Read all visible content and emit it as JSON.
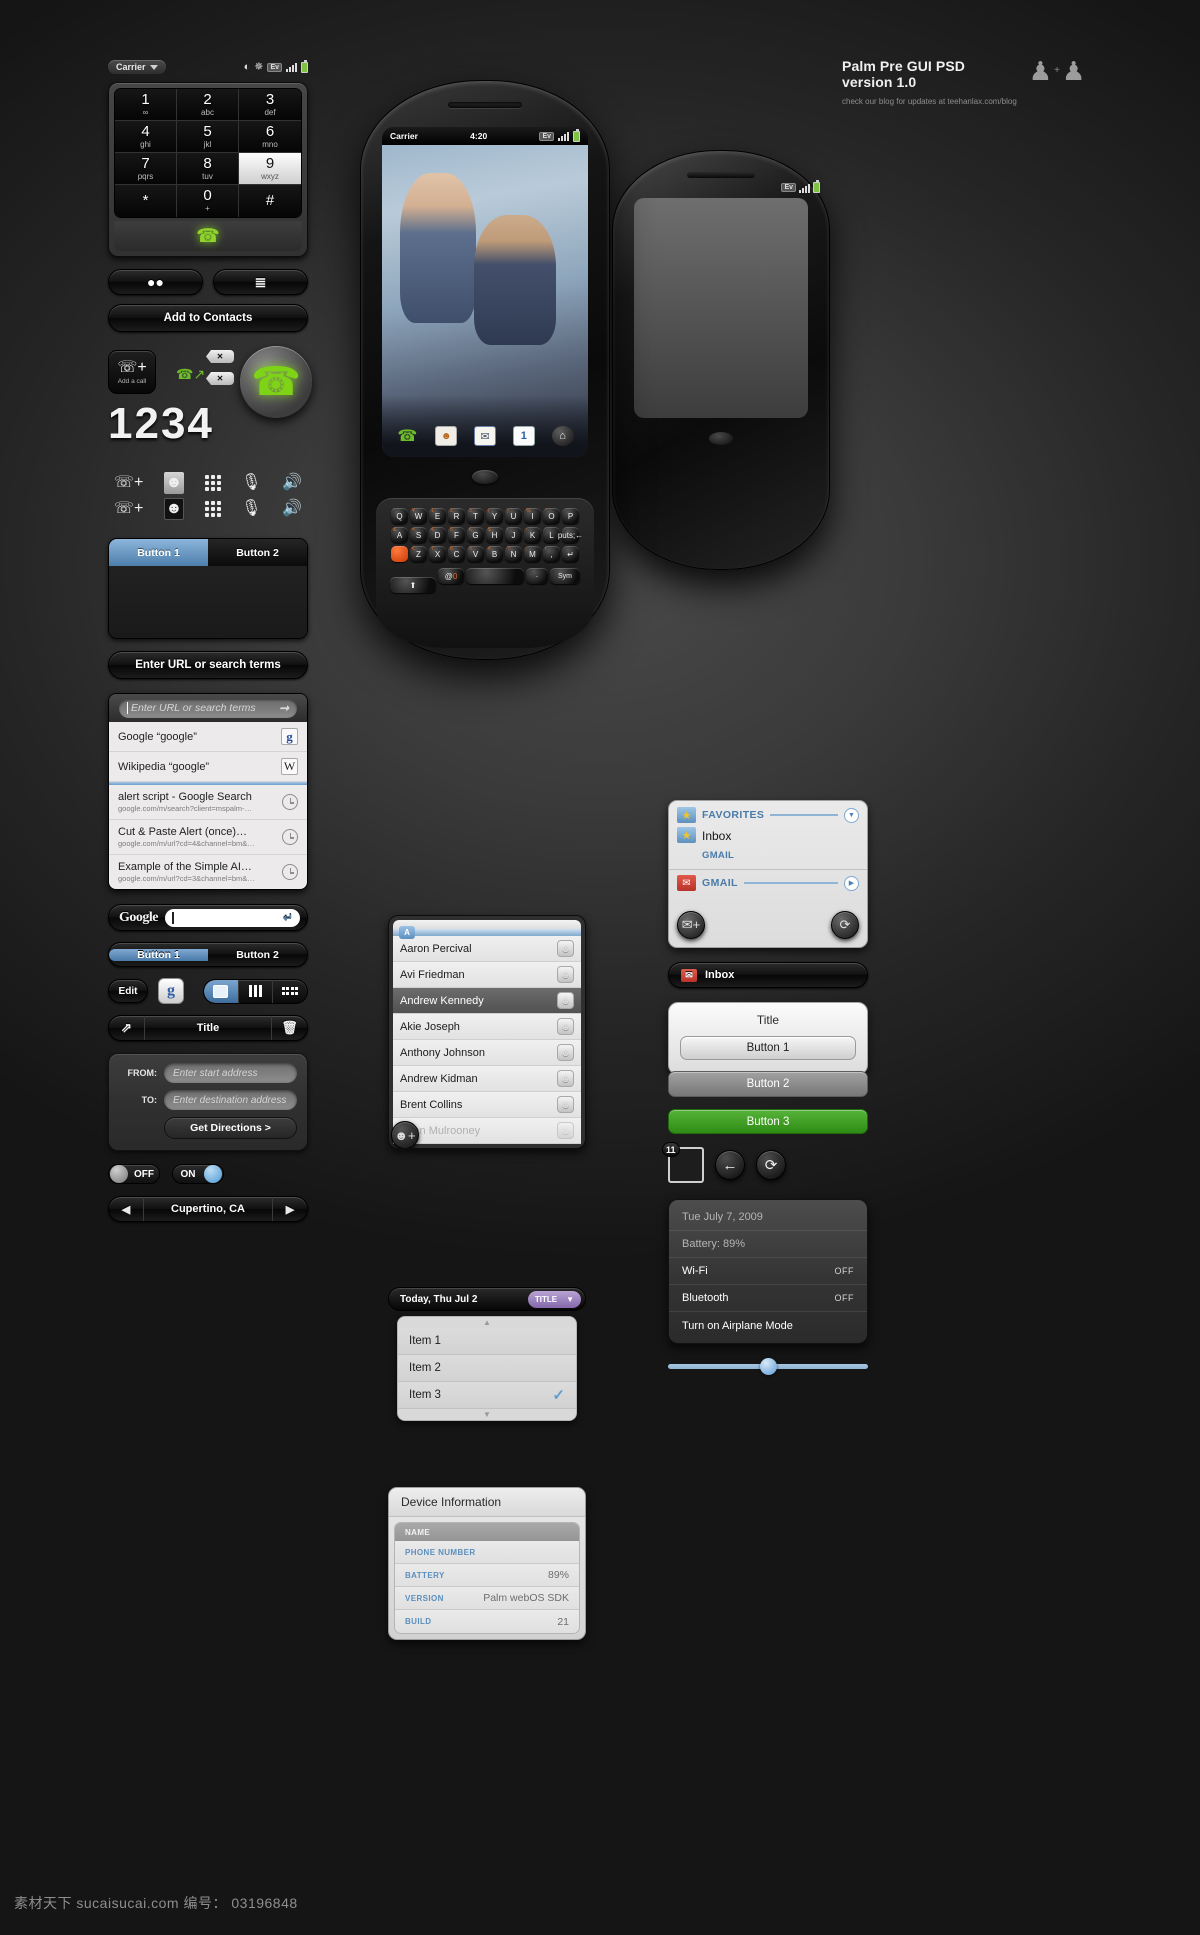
{
  "header": {
    "title_line1": "Palm Pre GUI PSD",
    "title_line2": "version 1.0",
    "subtitle": "check our blog for updates at teehanlax.com/blog",
    "people_icon": "people-icon",
    "plus": "+"
  },
  "watermark": "素材天下 sucaisucai.com  编号： 03196848",
  "status_bar": {
    "carrier": "Carrier",
    "wifi_icon": "wifi-icon",
    "bluetooth_icon": "bluetooth-icon",
    "ev_label": "Ev",
    "signal_icon": "signal-bars-icon",
    "battery_icon": "battery-icon"
  },
  "dialpad": {
    "keys": [
      {
        "num": "1",
        "sub": "∞"
      },
      {
        "num": "2",
        "sub": "abc"
      },
      {
        "num": "3",
        "sub": "def"
      },
      {
        "num": "4",
        "sub": "ghi"
      },
      {
        "num": "5",
        "sub": "jkl"
      },
      {
        "num": "6",
        "sub": "mno"
      },
      {
        "num": "7",
        "sub": "pqrs"
      },
      {
        "num": "8",
        "sub": "tuv"
      },
      {
        "num": "9",
        "sub": "wxyz"
      },
      {
        "num": "*",
        "sub": ""
      },
      {
        "num": "0",
        "sub": "+"
      },
      {
        "num": "#",
        "sub": ""
      }
    ],
    "highlighted_key": "9",
    "call_icon": "green-phone-call-icon"
  },
  "phone_buttons": {
    "voicemail_icon": "voicemail-icon",
    "calllist_icon": "call-list-icon",
    "add_to_contacts": "Add to Contacts"
  },
  "call_cluster": {
    "add_a_call": "Add a call",
    "add_call_icon": "phone-plus-icon",
    "transfer_icon": "call-transfer-icon",
    "delete_tag1": "✕",
    "delete_tag2": "✕",
    "dialed_number": "1234",
    "orb_icon": "phone-speaker-orb-icon"
  },
  "icon_rows": {
    "row1": [
      "add-call-icon",
      "contacts-icon",
      "dialpad-icon",
      "mute-icon",
      "speaker-icon"
    ],
    "row2": [
      "add-call-icon",
      "contacts-icon-active",
      "dialpad-icon",
      "mute-icon",
      "speaker-icon"
    ]
  },
  "tab_block": {
    "tab1": "Button 1",
    "tab2": "Button 2",
    "active": "Button 1"
  },
  "search_pill": "Enter URL or search terms",
  "url_panel": {
    "placeholder": "Enter URL or search terms",
    "go_icon": "arrow-right-icon",
    "results": [
      {
        "title": "Google “google”",
        "sub": "",
        "badge": "g"
      },
      {
        "title": "Wikipedia “google”",
        "sub": "",
        "badge": "W"
      },
      {
        "title": "alert script - Google Search",
        "sub": "google.com/m/search?client=mspalm-…",
        "badge": "clock"
      },
      {
        "title": "Cut & Paste Alert (once)…",
        "sub": "google.com/m/url?cd=4&channel=bm&…",
        "badge": "clock"
      },
      {
        "title": "Example of the Simple AI…",
        "sub": "google.com/m/url?cd=3&channel=bm&…",
        "badge": "clock"
      }
    ]
  },
  "google_bar": {
    "logo": "Google",
    "value": "",
    "enter_icon": "return-arrow-icon"
  },
  "seg_buttons": {
    "b1": "Button 1",
    "b2": "Button 2",
    "active": "Button 1"
  },
  "tool_row": {
    "edit": "Edit",
    "g_tile": "g",
    "view_icons": [
      "page-view-icon",
      "columns-view-icon",
      "grid-view-icon"
    ],
    "active_view": "page-view-icon"
  },
  "title_bar": {
    "share_icon": "share-icon",
    "title": "Title",
    "trash_icon": "trash-icon"
  },
  "directions": {
    "from_label": "FROM:",
    "from_placeholder": "Enter start address",
    "to_label": "TO:",
    "to_placeholder": "Enter destination address",
    "button": "Get Directions >"
  },
  "toggles": {
    "off": "OFF",
    "on": "ON"
  },
  "stepper": {
    "prev_icon": "triangle-left-icon",
    "value": "Cupertino, CA",
    "next_icon": "triangle-right-icon"
  },
  "center_phone": {
    "status": {
      "carrier": "Carrier",
      "time": "4:20",
      "ev": "Ev"
    },
    "dock_icons": [
      "phone-icon",
      "contacts-card-icon",
      "email-icon",
      "calendar-icon",
      "home-icon"
    ],
    "calendar_day": "1",
    "keyboard": {
      "row1": [
        "Q",
        "W",
        "E",
        "R",
        "T",
        "Y",
        "U",
        "I",
        "O",
        "P"
      ],
      "row1_sup": [
        "'",
        "¥",
        "1",
        "2",
        "3",
        "(",
        ")",
        "%",
        "\"",
        ""
      ],
      "row2": [
        "A",
        "S",
        "D",
        "F",
        "G",
        "H",
        "J",
        "K",
        "L",
        "⌫"
      ],
      "row2_sup": [
        "&",
        "=",
        "4",
        "5",
        "6",
        "$",
        "!",
        ":",
        "'",
        ""
      ],
      "row3": [
        "◼",
        "Z",
        "X",
        "C",
        "V",
        "B",
        "N",
        "M",
        ",",
        "↵"
      ],
      "row3_sup": [
        "",
        "€",
        "7",
        "8",
        "9",
        "#",
        "?",
        ";",
        "/",
        ""
      ],
      "row4": [
        "⬆",
        "@0",
        "",
        "·",
        "Sym"
      ]
    }
  },
  "right_phone": {
    "ev": "Ev"
  },
  "contacts": {
    "section_letter": "A",
    "add_icon": "add-contact-icon",
    "items": [
      {
        "name": "Aaron Percival",
        "state": "normal"
      },
      {
        "name": "Avi Friedman",
        "state": "normal"
      },
      {
        "name": "Andrew Kennedy",
        "state": "selected"
      },
      {
        "name": "Akie Joseph",
        "state": "normal"
      },
      {
        "name": "Anthony Johnson",
        "state": "normal"
      },
      {
        "name": "Andrew Kidman",
        "state": "normal"
      },
      {
        "name": "Brent Collins",
        "state": "normal"
      },
      {
        "name": "Brian Mulrooney",
        "state": "dim"
      }
    ]
  },
  "today": {
    "label": "Today, Thu Jul 2",
    "chip": "TITLE",
    "chip_caret": "▼",
    "items": [
      "Item 1",
      "Item 2",
      "Item 3"
    ],
    "checked": "Item 3",
    "up_icon": "chevron-up-icon",
    "down_icon": "chevron-down-icon"
  },
  "device_info": {
    "title": "Device Information",
    "rows": [
      {
        "key": "NAME",
        "value": ""
      },
      {
        "key": "PHONE NUMBER",
        "value": ""
      },
      {
        "key": "BATTERY",
        "value": "89%"
      },
      {
        "key": "VERSION",
        "value": "Palm webOS SDK"
      },
      {
        "key": "BUILD",
        "value": "21"
      }
    ]
  },
  "mail_panel": {
    "favorites_label": "FAVORITES",
    "favorites_icon": "folder-star-icon",
    "favorites_toggle_icon": "chevron-down-circle-icon",
    "inbox_title": "Inbox",
    "inbox_account": "GMAIL",
    "inbox_icon": "folder-star-icon",
    "gmail_label": "GMAIL",
    "gmail_icon": "gmail-icon",
    "gmail_toggle_icon": "play-circle-icon",
    "compose_icon": "new-message-icon",
    "refresh_icon": "refresh-icon"
  },
  "inbox_pill": {
    "label": "Inbox",
    "icon": "gmail-icon"
  },
  "title_card": {
    "title": "Title",
    "button1": "Button 1",
    "button2": "Button 2",
    "button3": "Button 3"
  },
  "misc_row": {
    "badge_count": "11",
    "back_icon": "arrow-left-icon",
    "refresh_icon": "refresh-icon"
  },
  "status_card": {
    "date": "Tue July 7, 2009",
    "battery": "Battery: 89%",
    "rows": [
      {
        "key": "Wi-Fi",
        "value": "OFF"
      },
      {
        "key": "Bluetooth",
        "value": "OFF"
      }
    ],
    "airplane": "Turn on Airplane Mode"
  },
  "slider": {
    "value": 46
  },
  "colors": {
    "accent_blue": "#4d7fab",
    "green": "#2e8c14",
    "purple": "#8468ab",
    "link_blue": "#5c8fbf"
  }
}
